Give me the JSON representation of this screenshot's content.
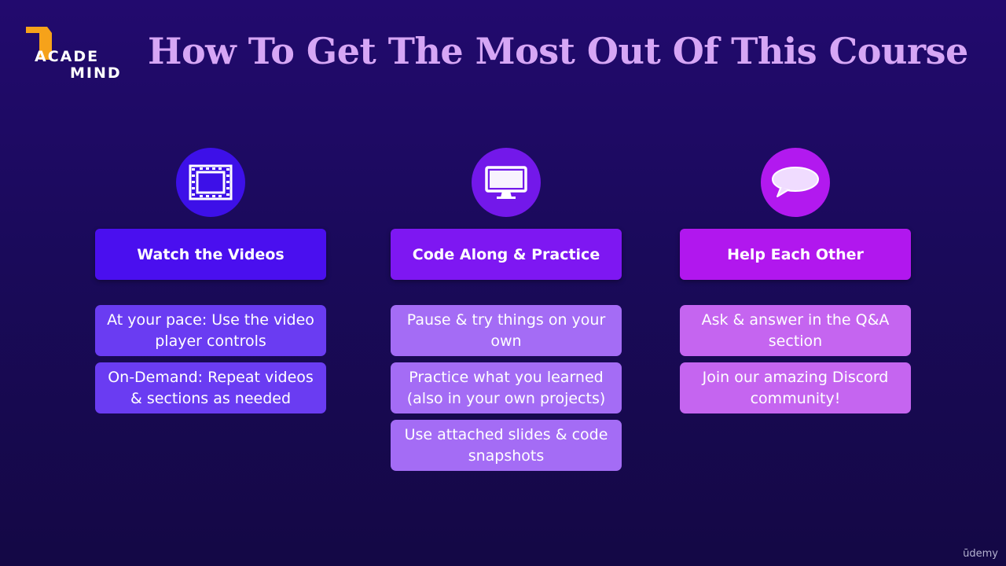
{
  "logo": {
    "line1": "ACADE",
    "line2": "MIND"
  },
  "slide": {
    "title": "How To Get The Most Out Of This Course"
  },
  "columns": [
    {
      "icon": "film-icon",
      "header": "Watch the Videos",
      "items": [
        "At your pace: Use the video player controls",
        "On-Demand: Repeat videos & sections as needed"
      ]
    },
    {
      "icon": "monitor-icon",
      "header": "Code Along & Practice",
      "items": [
        "Pause & try things on your own",
        "Practice what you learned (also in your own projects)",
        "Use attached slides & code snapshots"
      ]
    },
    {
      "icon": "speech-bubble-icon",
      "header": "Help Each Other",
      "items": [
        "Ask & answer in the Q&A section",
        "Join our amazing Discord community!"
      ]
    }
  ],
  "watermark": "ūdemy",
  "colors": {
    "background": "#1a0a5a",
    "title": "#d6a6f5",
    "col1_header": "#4a0fef",
    "col2_header": "#7e17f2",
    "col3_header": "#b117ee",
    "flag": "#f6a21a"
  }
}
